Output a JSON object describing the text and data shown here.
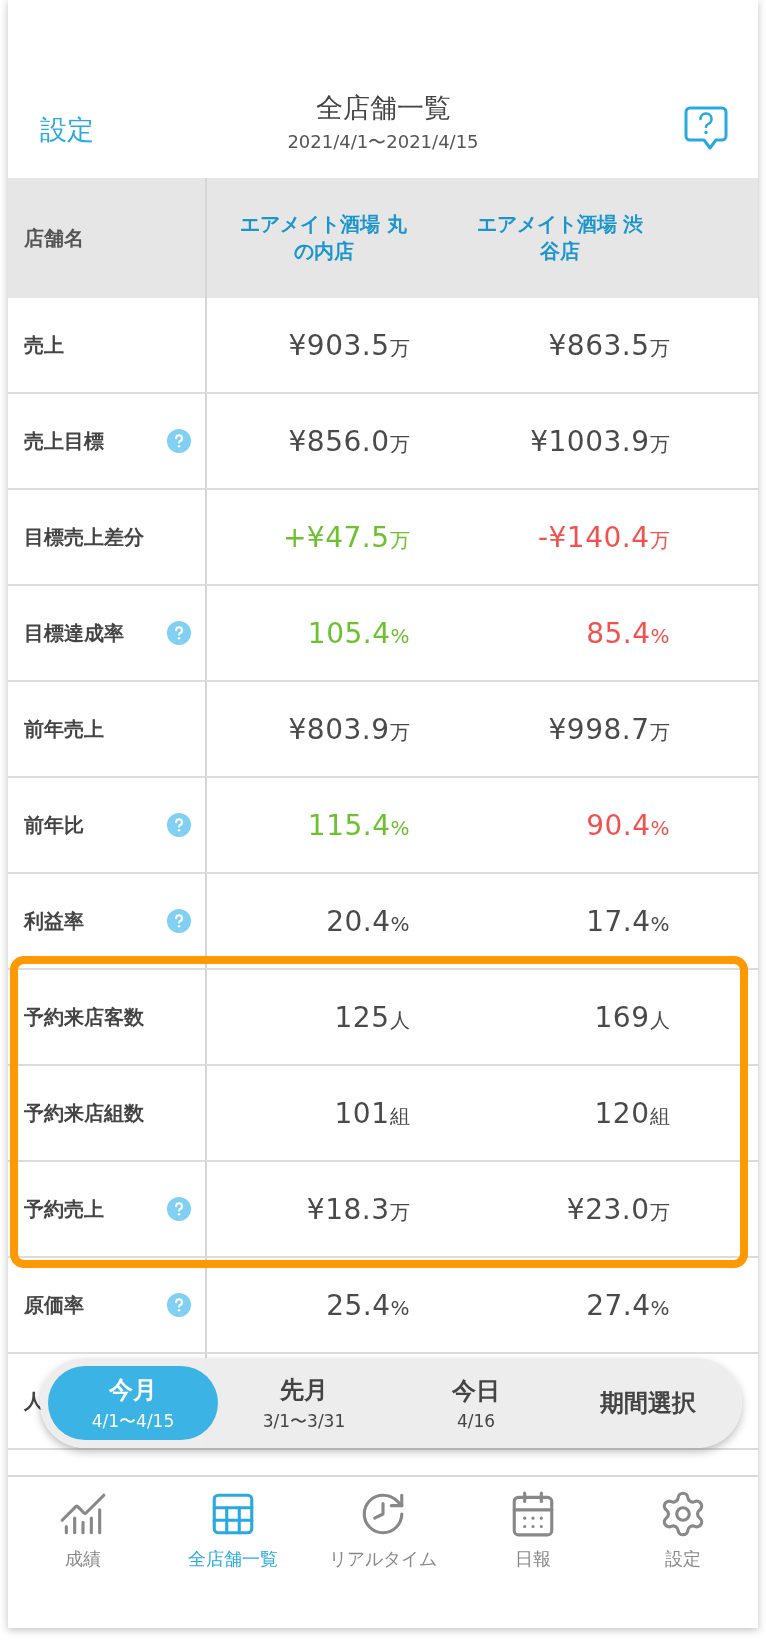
{
  "header": {
    "back_link": "設定",
    "title": "全店舗一覧",
    "period": "2021/4/1〜2021/4/15"
  },
  "table": {
    "corner": "店舗名",
    "stores": [
      "エアメイト酒場 丸の内店",
      "エアメイト酒場 渋谷店"
    ],
    "rows": [
      {
        "label": "売上",
        "help": false,
        "highlighted": false,
        "values": [
          {
            "amount": "¥903.5",
            "unit": "万",
            "color": "#4a4a4a"
          },
          {
            "amount": "¥863.5",
            "unit": "万",
            "color": "#4a4a4a"
          }
        ]
      },
      {
        "label": "売上目標",
        "help": true,
        "highlighted": false,
        "values": [
          {
            "amount": "¥856.0",
            "unit": "万",
            "color": "#4a4a4a"
          },
          {
            "amount": "¥1003.9",
            "unit": "万",
            "color": "#4a4a4a"
          }
        ]
      },
      {
        "label": "目標売上差分",
        "help": false,
        "highlighted": false,
        "values": [
          {
            "amount": "+¥47.5",
            "unit": "万",
            "color": "#6cc12f"
          },
          {
            "amount": "-¥140.4",
            "unit": "万",
            "color": "#f0534f"
          }
        ]
      },
      {
        "label": "目標達成率",
        "help": true,
        "highlighted": false,
        "values": [
          {
            "amount": "105.4",
            "unit": "%",
            "color": "#6cc12f"
          },
          {
            "amount": "85.4",
            "unit": "%",
            "color": "#f0534f"
          }
        ]
      },
      {
        "label": "前年売上",
        "help": false,
        "highlighted": false,
        "values": [
          {
            "amount": "¥803.9",
            "unit": "万",
            "color": "#4a4a4a"
          },
          {
            "amount": "¥998.7",
            "unit": "万",
            "color": "#4a4a4a"
          }
        ]
      },
      {
        "label": "前年比",
        "help": true,
        "highlighted": false,
        "values": [
          {
            "amount": "115.4",
            "unit": "%",
            "color": "#6cc12f"
          },
          {
            "amount": "90.4",
            "unit": "%",
            "color": "#f0534f"
          }
        ]
      },
      {
        "label": "利益率",
        "help": true,
        "highlighted": false,
        "values": [
          {
            "amount": "20.4",
            "unit": "%",
            "color": "#4a4a4a"
          },
          {
            "amount": "17.4",
            "unit": "%",
            "color": "#4a4a4a"
          }
        ]
      },
      {
        "label": "予約来店客数",
        "help": false,
        "highlighted": true,
        "values": [
          {
            "amount": "125",
            "unit": "人",
            "color": "#4a4a4a"
          },
          {
            "amount": "169",
            "unit": "人",
            "color": "#4a4a4a"
          }
        ]
      },
      {
        "label": "予約来店組数",
        "help": false,
        "highlighted": true,
        "values": [
          {
            "amount": "101",
            "unit": "組",
            "color": "#4a4a4a"
          },
          {
            "amount": "120",
            "unit": "組",
            "color": "#4a4a4a"
          }
        ]
      },
      {
        "label": "予約売上",
        "help": true,
        "highlighted": true,
        "values": [
          {
            "amount": "¥18.3",
            "unit": "万",
            "color": "#4a4a4a"
          },
          {
            "amount": "¥23.0",
            "unit": "万",
            "color": "#4a4a4a"
          }
        ]
      },
      {
        "label": "原価率",
        "help": true,
        "highlighted": false,
        "values": [
          {
            "amount": "25.4",
            "unit": "%",
            "color": "#4a4a4a"
          },
          {
            "amount": "27.4",
            "unit": "%",
            "color": "#4a4a4a"
          }
        ]
      },
      {
        "label": "人",
        "help": false,
        "highlighted": false,
        "values": []
      }
    ]
  },
  "period_picker": [
    {
      "label": "今月",
      "range": "4/1〜4/15",
      "selected": true
    },
    {
      "label": "先月",
      "range": "3/1〜3/31",
      "selected": false
    },
    {
      "label": "今日",
      "range": "4/16",
      "selected": false
    },
    {
      "label": "期間選択",
      "selected": false
    }
  ],
  "tab_bar": [
    {
      "kind": "results",
      "label": "成績",
      "selected": false
    },
    {
      "kind": "stores",
      "label": "全店舗一覧",
      "selected": true
    },
    {
      "kind": "realtime",
      "label": "リアルタイム",
      "selected": false
    },
    {
      "kind": "daily",
      "label": "日報",
      "selected": false
    },
    {
      "kind": "settings",
      "label": "設定",
      "selected": false
    }
  ]
}
